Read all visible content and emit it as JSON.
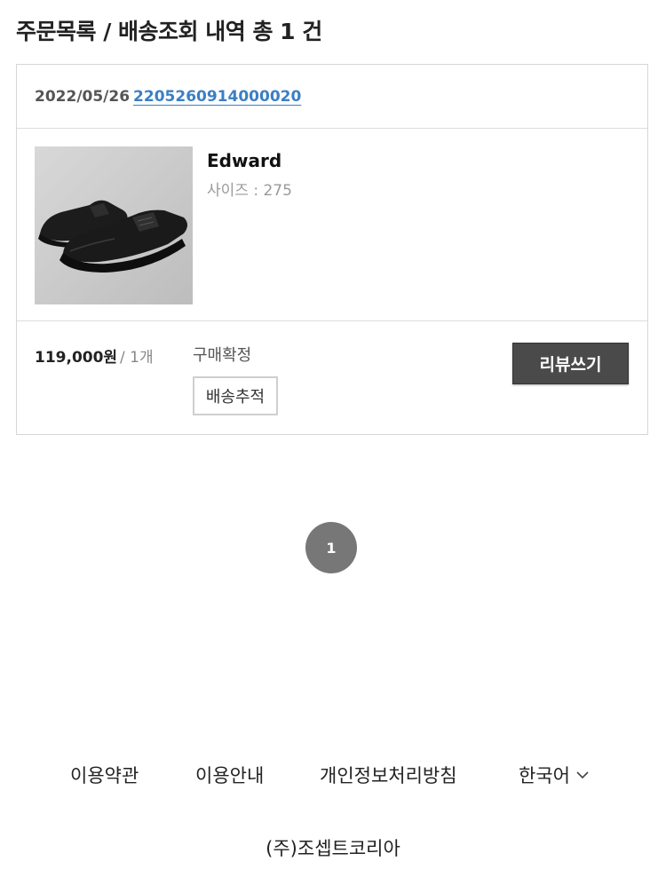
{
  "page": {
    "title": "주문목록 / 배송조회 내역 총 1 건"
  },
  "order": {
    "date": "2022/05/26",
    "number": "2205260914000020",
    "product": {
      "name": "Edward",
      "option": "사이즈 : 275"
    },
    "price": "119,000원",
    "qty": "/ 1개",
    "status": "구매확정",
    "track_label": "배송추적",
    "review_label": "리뷰쓰기"
  },
  "pagination": {
    "current": "1"
  },
  "footer": {
    "links": [
      "이용약관",
      "이용안내",
      "개인정보처리방침"
    ],
    "language": "한국어",
    "company": "(주)조셉트코리아"
  },
  "colors": {
    "link": "#3b7fc4",
    "button_dark": "#4a4a4a",
    "pager": "#777777"
  }
}
